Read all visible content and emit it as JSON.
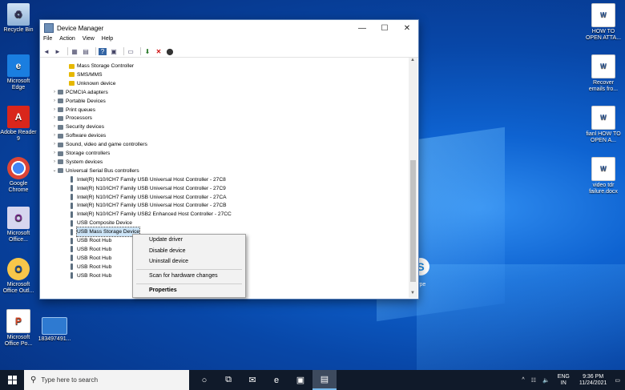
{
  "desktop": {
    "icons_left": [
      {
        "label": "Recycle Bin",
        "icon": "recycle-bin-icon",
        "glyph": "♻"
      },
      {
        "label": "Microsoft Edge",
        "icon": "edge-icon",
        "glyph": "e"
      },
      {
        "label": "Adobe Reader 9",
        "icon": "adobe-reader-icon",
        "glyph": "A"
      },
      {
        "label": "Google Chrome",
        "icon": "chrome-icon",
        "glyph": ""
      },
      {
        "label": "Microsoft Office...",
        "icon": "office-icon",
        "glyph": "O"
      },
      {
        "label": "Microsoft Office Outl...",
        "icon": "outlook-icon",
        "glyph": "O"
      },
      {
        "label": "Microsoft Office Po...",
        "icon": "powerpoint-icon",
        "glyph": "P"
      }
    ],
    "icons_right": [
      {
        "label": "HOW TO OPEN ATTA...",
        "icon": "word-doc-icon",
        "glyph": "W"
      },
      {
        "label": "Recover emails fro...",
        "icon": "word-doc-icon",
        "glyph": "W"
      },
      {
        "label": "fianl HOW TO OPEN A...",
        "icon": "word-doc-icon",
        "glyph": "W"
      },
      {
        "label": "video tdr failure.docx",
        "icon": "word-doc-icon",
        "glyph": "W"
      }
    ],
    "file_icon": {
      "label": "183497491...",
      "icon": "file-icon"
    },
    "wallpaper_text": "ype"
  },
  "window": {
    "title": "Device Manager",
    "buttons": {
      "minimize": "—",
      "maximize": "☐",
      "close": "✕"
    },
    "menu": [
      "File",
      "Action",
      "View",
      "Help"
    ],
    "toolbar_glyphs": [
      "◄",
      "►",
      "▦",
      "▤",
      "?",
      "▣",
      "▭",
      "⬇",
      "✕",
      "⬤"
    ],
    "tree": [
      {
        "label": "Mass Storage Controller",
        "level": 2,
        "icon": "warn"
      },
      {
        "label": "SMS/MMS",
        "level": 2,
        "icon": "warn"
      },
      {
        "label": "Unknown device",
        "level": 2,
        "icon": "warn"
      },
      {
        "label": "PCMCIA adapters",
        "level": 1,
        "icon": "dev",
        "expander": "›"
      },
      {
        "label": "Portable Devices",
        "level": 1,
        "icon": "dev",
        "expander": "›"
      },
      {
        "label": "Print queues",
        "level": 1,
        "icon": "dev",
        "expander": "›"
      },
      {
        "label": "Processors",
        "level": 1,
        "icon": "dev",
        "expander": "›"
      },
      {
        "label": "Security devices",
        "level": 1,
        "icon": "dev",
        "expander": "›"
      },
      {
        "label": "Software devices",
        "level": 1,
        "icon": "dev",
        "expander": "›"
      },
      {
        "label": "Sound, video and game controllers",
        "level": 1,
        "icon": "dev",
        "expander": "›"
      },
      {
        "label": "Storage controllers",
        "level": 1,
        "icon": "dev",
        "expander": "›"
      },
      {
        "label": "System devices",
        "level": 1,
        "icon": "dev",
        "expander": "›"
      },
      {
        "label": "Universal Serial Bus controllers",
        "level": 1,
        "icon": "dev",
        "expander": "⌄"
      },
      {
        "label": "Intel(R) N10/ICH7 Family USB Universal Host Controller - 27C8",
        "level": 2,
        "icon": "usb"
      },
      {
        "label": "Intel(R) N10/ICH7 Family USB Universal Host Controller - 27C9",
        "level": 2,
        "icon": "usb"
      },
      {
        "label": "Intel(R) N10/ICH7 Family USB Universal Host Controller - 27CA",
        "level": 2,
        "icon": "usb"
      },
      {
        "label": "Intel(R) N10/ICH7 Family USB Universal Host Controller - 27CB",
        "level": 2,
        "icon": "usb"
      },
      {
        "label": "Intel(R) N10/ICH7 Family USB2 Enhanced Host Controller - 27CC",
        "level": 2,
        "icon": "usb"
      },
      {
        "label": "USB Composite Device",
        "level": 2,
        "icon": "usb"
      },
      {
        "label": "USB Mass Storage Device",
        "level": 2,
        "icon": "usb",
        "selected": true
      },
      {
        "label": "USB Root Hub",
        "level": 2,
        "icon": "usb"
      },
      {
        "label": "USB Root Hub",
        "level": 2,
        "icon": "usb"
      },
      {
        "label": "USB Root Hub",
        "level": 2,
        "icon": "usb"
      },
      {
        "label": "USB Root Hub",
        "level": 2,
        "icon": "usb"
      },
      {
        "label": "USB Root Hub",
        "level": 2,
        "icon": "usb"
      }
    ]
  },
  "context_menu": {
    "update": "Update driver",
    "disable": "Disable device",
    "uninstall": "Uninstall device",
    "scan": "Scan for hardware changes",
    "properties": "Properties"
  },
  "taskbar": {
    "search_placeholder": "Type here to search",
    "search_glyph": "⚲",
    "icons": [
      {
        "name": "cortana-icon",
        "glyph": "○"
      },
      {
        "name": "task-view-icon",
        "glyph": "⧉"
      },
      {
        "name": "mail-icon",
        "glyph": "✉"
      },
      {
        "name": "edge-icon",
        "glyph": "e"
      },
      {
        "name": "store-icon",
        "glyph": "▣"
      },
      {
        "name": "device-manager-icon",
        "glyph": "▤",
        "active": true
      }
    ],
    "tray": {
      "chevron": "^",
      "network": "☷",
      "volume": "🔈",
      "lang_top": "ENG",
      "lang_bottom": "IN",
      "time": "9:36 PM",
      "date": "11/24/2021",
      "notification": "▭"
    }
  }
}
